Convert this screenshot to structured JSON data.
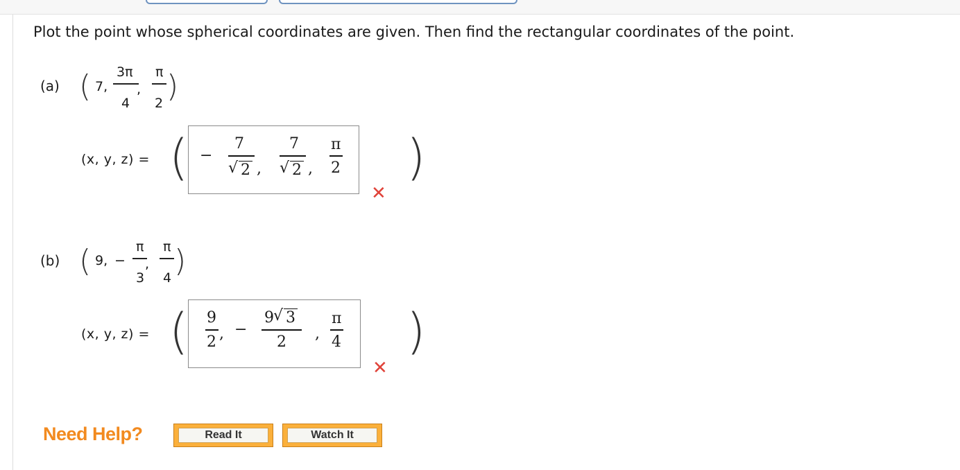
{
  "question": "Plot the point whose spherical coordinates are given. Then find the rectangular coordinates of the point.",
  "parts": [
    {
      "label": "(a)",
      "given": {
        "rho": "7,",
        "theta_num": "3π",
        "theta_den": "4",
        "phi_num": "π",
        "phi_den": "2"
      },
      "xyz_label": "(x, y, z) =",
      "answer": {
        "neg": "−",
        "x_num": "7",
        "x_den": "2",
        "y_num": "7",
        "y_den": "2",
        "z_num": "π",
        "z_den": "2"
      },
      "status": "incorrect"
    },
    {
      "label": "(b)",
      "given": {
        "rho": "9,",
        "theta_sign": "−",
        "theta_num": "π",
        "theta_den": "3",
        "phi_num": "π",
        "phi_den": "4"
      },
      "xyz_label": "(x, y, z) =",
      "answer": {
        "x_num": "9",
        "x_den": "2",
        "neg": "−",
        "y_num": "9",
        "y_rad": "3",
        "y_den": "2",
        "z_num": "π",
        "z_den": "4"
      },
      "status": "incorrect"
    }
  ],
  "help": {
    "label": "Need Help?",
    "read_it": "Read It",
    "watch_it": "Watch It"
  },
  "colors": {
    "error": "#e0433a",
    "help_orange": "#f28a1f",
    "button_orange": "#fbb03b"
  },
  "icons": {
    "incorrect": "x-mark-icon"
  }
}
